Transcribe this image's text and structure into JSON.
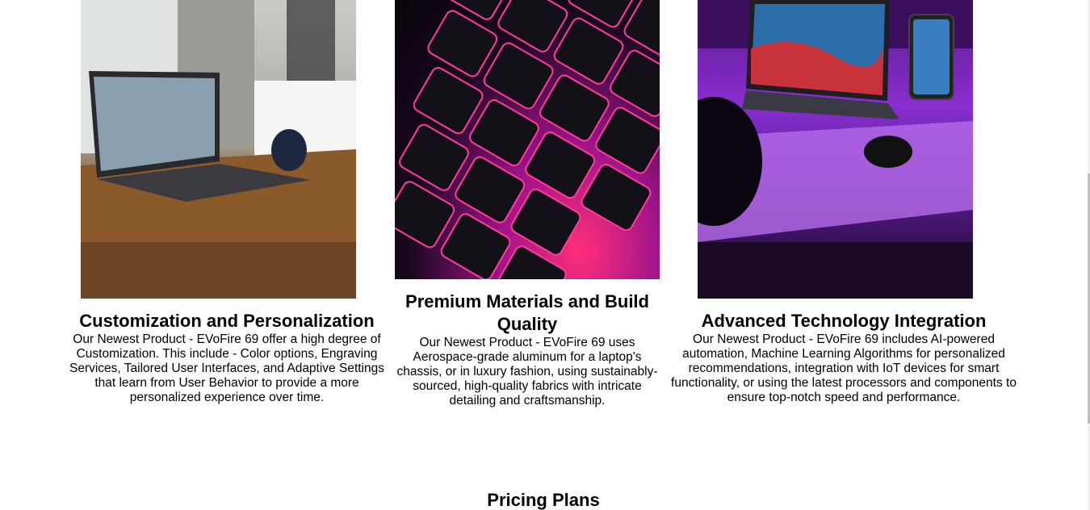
{
  "features": [
    {
      "title": "Customization and Personalization",
      "description": "Our Newest Product - EVoFire 69 offer a high degree of Customization. This include - Color options, Engraving Services, Tailored User Interfaces, and Adaptive Settings that learn from User Behavior to provide a more personalized experience over time."
    },
    {
      "title": "Premium Materials and Build Quality",
      "description": "Our Newest Product - EVoFire 69 uses Aerospace-grade aluminum for a laptop's chassis, or in luxury fashion, using sustainably-sourced, high-quality fabrics with intricate detailing and craftsmanship."
    },
    {
      "title": "Advanced Technology Integration",
      "description": "Our Newest Product - EVoFire 69 includes AI-powered automation, Machine Learning Algorithms for personalized recommendations, integration with IoT devices for smart functionality, or using the latest processors and components to ensure top-notch speed and performance."
    }
  ],
  "pricing": {
    "title": "Pricing Plans"
  },
  "colors": {
    "text": "#000000",
    "background": "#ffffff"
  }
}
